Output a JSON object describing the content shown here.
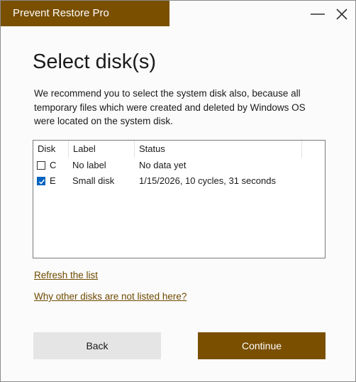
{
  "app": {
    "title": "Prevent Restore Pro",
    "accent_color": "#7a4f00"
  },
  "window_controls": {
    "minimize_icon": "minimize-icon",
    "close_icon": "close-icon"
  },
  "page": {
    "heading": "Select disk(s)",
    "description": "We recommend you to select the system disk also, because all temporary files which were created and deleted by Windows OS were located on the system disk."
  },
  "disk_list": {
    "columns": [
      "Disk",
      "Label",
      "Status"
    ],
    "rows": [
      {
        "checked": false,
        "disk": "C",
        "label": "No label",
        "status": "No data yet"
      },
      {
        "checked": true,
        "disk": "E",
        "label": "Small disk",
        "status": "1/15/2026, 10 cycles, 31 seconds"
      }
    ]
  },
  "links": {
    "refresh": "Refresh the list",
    "why": "Why other disks are not listed here?"
  },
  "buttons": {
    "back": "Back",
    "continue": "Continue"
  }
}
